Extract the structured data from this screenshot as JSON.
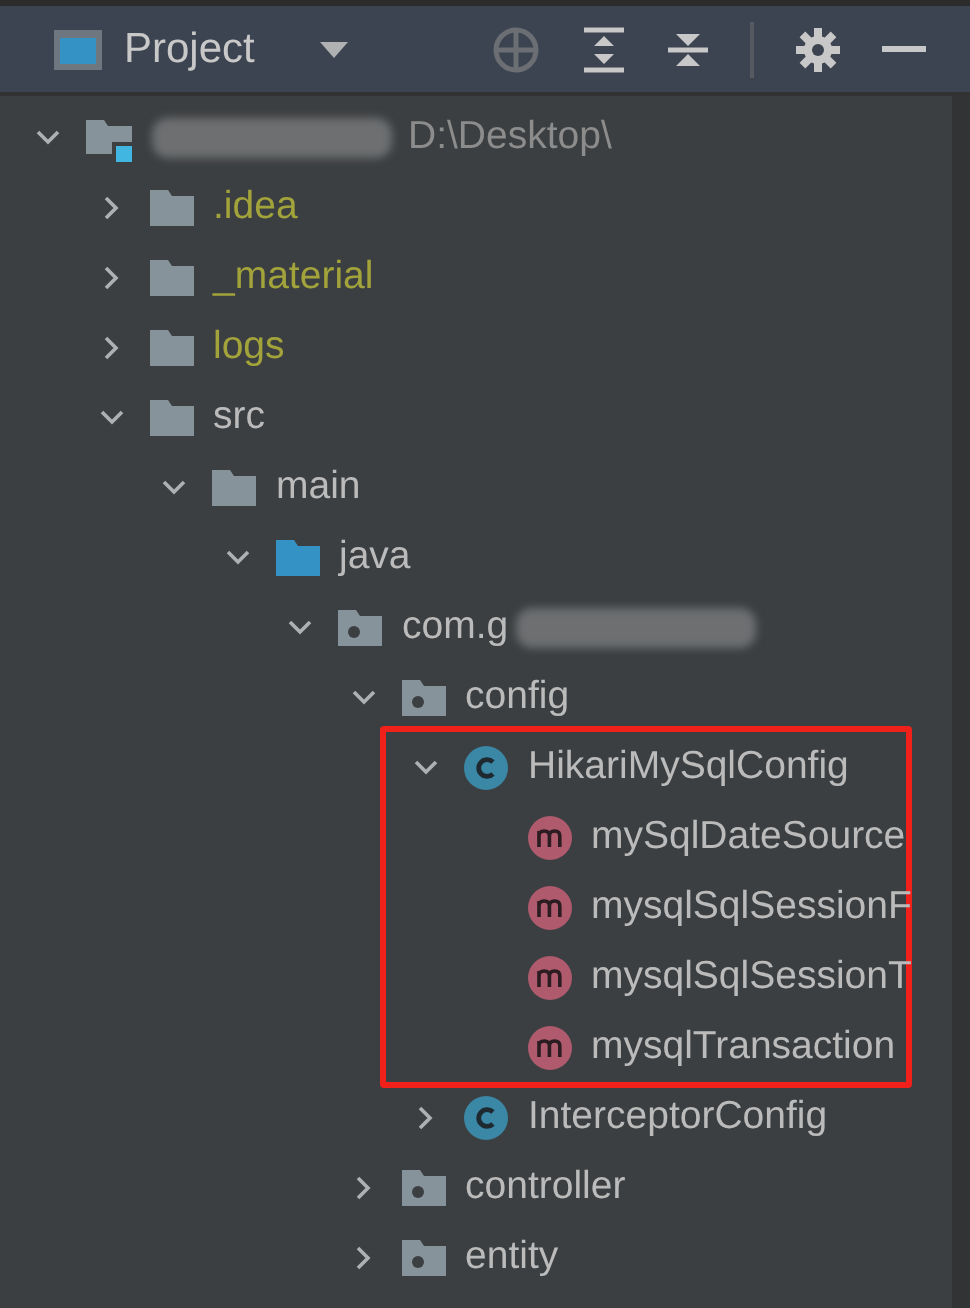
{
  "header": {
    "title": "Project"
  },
  "tree": [
    {
      "kind": "module",
      "redacted": true,
      "path": "D:\\Desktop\\",
      "expanded": true,
      "children": [
        {
          "kind": "folder",
          "label": ".idea",
          "ignored": true,
          "expanded": false
        },
        {
          "kind": "folder",
          "label": "_material",
          "ignored": true,
          "expanded": false
        },
        {
          "kind": "folder",
          "label": "logs",
          "ignored": true,
          "expanded": false
        },
        {
          "kind": "folder",
          "label": "src",
          "expanded": true,
          "children": [
            {
              "kind": "folder",
              "label": "main",
              "expanded": true,
              "children": [
                {
                  "kind": "source",
                  "label": "java",
                  "expanded": true,
                  "children": [
                    {
                      "kind": "package",
                      "label": "com.g",
                      "redacted": true,
                      "expanded": true,
                      "children": [
                        {
                          "kind": "package",
                          "label": "config",
                          "expanded": true,
                          "children": [
                            {
                              "kind": "class",
                              "label": "HikariMySqlConfig",
                              "expanded": true,
                              "annotated": true,
                              "children": [
                                {
                                  "kind": "method",
                                  "label": "mySqlDateSource"
                                },
                                {
                                  "kind": "method",
                                  "label": "mysqlSqlSessionF"
                                },
                                {
                                  "kind": "method",
                                  "label": "mysqlSqlSessionT"
                                },
                                {
                                  "kind": "method",
                                  "label": "mysqlTransaction"
                                }
                              ]
                            },
                            {
                              "kind": "class",
                              "label": "InterceptorConfig",
                              "expanded": false
                            }
                          ]
                        },
                        {
                          "kind": "package",
                          "label": "controller",
                          "expanded": false
                        },
                        {
                          "kind": "package",
                          "label": "entity",
                          "expanded": false
                        }
                      ]
                    }
                  ]
                }
              ]
            }
          ]
        }
      ]
    }
  ]
}
